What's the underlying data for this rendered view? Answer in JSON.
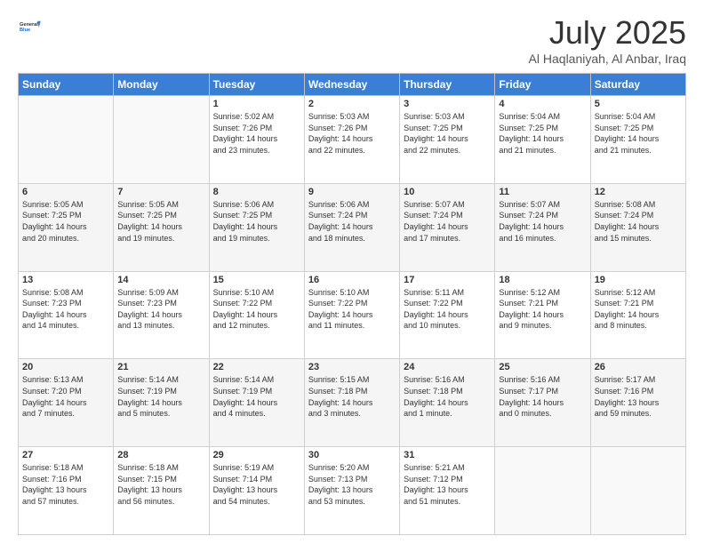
{
  "header": {
    "logo_line1": "General",
    "logo_line2": "Blue",
    "month": "July 2025",
    "location": "Al Haqlaniyah, Al Anbar, Iraq"
  },
  "weekdays": [
    "Sunday",
    "Monday",
    "Tuesday",
    "Wednesday",
    "Thursday",
    "Friday",
    "Saturday"
  ],
  "weeks": [
    [
      {
        "day": "",
        "info": ""
      },
      {
        "day": "",
        "info": ""
      },
      {
        "day": "1",
        "info": "Sunrise: 5:02 AM\nSunset: 7:26 PM\nDaylight: 14 hours\nand 23 minutes."
      },
      {
        "day": "2",
        "info": "Sunrise: 5:03 AM\nSunset: 7:26 PM\nDaylight: 14 hours\nand 22 minutes."
      },
      {
        "day": "3",
        "info": "Sunrise: 5:03 AM\nSunset: 7:25 PM\nDaylight: 14 hours\nand 22 minutes."
      },
      {
        "day": "4",
        "info": "Sunrise: 5:04 AM\nSunset: 7:25 PM\nDaylight: 14 hours\nand 21 minutes."
      },
      {
        "day": "5",
        "info": "Sunrise: 5:04 AM\nSunset: 7:25 PM\nDaylight: 14 hours\nand 21 minutes."
      }
    ],
    [
      {
        "day": "6",
        "info": "Sunrise: 5:05 AM\nSunset: 7:25 PM\nDaylight: 14 hours\nand 20 minutes."
      },
      {
        "day": "7",
        "info": "Sunrise: 5:05 AM\nSunset: 7:25 PM\nDaylight: 14 hours\nand 19 minutes."
      },
      {
        "day": "8",
        "info": "Sunrise: 5:06 AM\nSunset: 7:25 PM\nDaylight: 14 hours\nand 19 minutes."
      },
      {
        "day": "9",
        "info": "Sunrise: 5:06 AM\nSunset: 7:24 PM\nDaylight: 14 hours\nand 18 minutes."
      },
      {
        "day": "10",
        "info": "Sunrise: 5:07 AM\nSunset: 7:24 PM\nDaylight: 14 hours\nand 17 minutes."
      },
      {
        "day": "11",
        "info": "Sunrise: 5:07 AM\nSunset: 7:24 PM\nDaylight: 14 hours\nand 16 minutes."
      },
      {
        "day": "12",
        "info": "Sunrise: 5:08 AM\nSunset: 7:24 PM\nDaylight: 14 hours\nand 15 minutes."
      }
    ],
    [
      {
        "day": "13",
        "info": "Sunrise: 5:08 AM\nSunset: 7:23 PM\nDaylight: 14 hours\nand 14 minutes."
      },
      {
        "day": "14",
        "info": "Sunrise: 5:09 AM\nSunset: 7:23 PM\nDaylight: 14 hours\nand 13 minutes."
      },
      {
        "day": "15",
        "info": "Sunrise: 5:10 AM\nSunset: 7:22 PM\nDaylight: 14 hours\nand 12 minutes."
      },
      {
        "day": "16",
        "info": "Sunrise: 5:10 AM\nSunset: 7:22 PM\nDaylight: 14 hours\nand 11 minutes."
      },
      {
        "day": "17",
        "info": "Sunrise: 5:11 AM\nSunset: 7:22 PM\nDaylight: 14 hours\nand 10 minutes."
      },
      {
        "day": "18",
        "info": "Sunrise: 5:12 AM\nSunset: 7:21 PM\nDaylight: 14 hours\nand 9 minutes."
      },
      {
        "day": "19",
        "info": "Sunrise: 5:12 AM\nSunset: 7:21 PM\nDaylight: 14 hours\nand 8 minutes."
      }
    ],
    [
      {
        "day": "20",
        "info": "Sunrise: 5:13 AM\nSunset: 7:20 PM\nDaylight: 14 hours\nand 7 minutes."
      },
      {
        "day": "21",
        "info": "Sunrise: 5:14 AM\nSunset: 7:19 PM\nDaylight: 14 hours\nand 5 minutes."
      },
      {
        "day": "22",
        "info": "Sunrise: 5:14 AM\nSunset: 7:19 PM\nDaylight: 14 hours\nand 4 minutes."
      },
      {
        "day": "23",
        "info": "Sunrise: 5:15 AM\nSunset: 7:18 PM\nDaylight: 14 hours\nand 3 minutes."
      },
      {
        "day": "24",
        "info": "Sunrise: 5:16 AM\nSunset: 7:18 PM\nDaylight: 14 hours\nand 1 minute."
      },
      {
        "day": "25",
        "info": "Sunrise: 5:16 AM\nSunset: 7:17 PM\nDaylight: 14 hours\nand 0 minutes."
      },
      {
        "day": "26",
        "info": "Sunrise: 5:17 AM\nSunset: 7:16 PM\nDaylight: 13 hours\nand 59 minutes."
      }
    ],
    [
      {
        "day": "27",
        "info": "Sunrise: 5:18 AM\nSunset: 7:16 PM\nDaylight: 13 hours\nand 57 minutes."
      },
      {
        "day": "28",
        "info": "Sunrise: 5:18 AM\nSunset: 7:15 PM\nDaylight: 13 hours\nand 56 minutes."
      },
      {
        "day": "29",
        "info": "Sunrise: 5:19 AM\nSunset: 7:14 PM\nDaylight: 13 hours\nand 54 minutes."
      },
      {
        "day": "30",
        "info": "Sunrise: 5:20 AM\nSunset: 7:13 PM\nDaylight: 13 hours\nand 53 minutes."
      },
      {
        "day": "31",
        "info": "Sunrise: 5:21 AM\nSunset: 7:12 PM\nDaylight: 13 hours\nand 51 minutes."
      },
      {
        "day": "",
        "info": ""
      },
      {
        "day": "",
        "info": ""
      }
    ]
  ]
}
